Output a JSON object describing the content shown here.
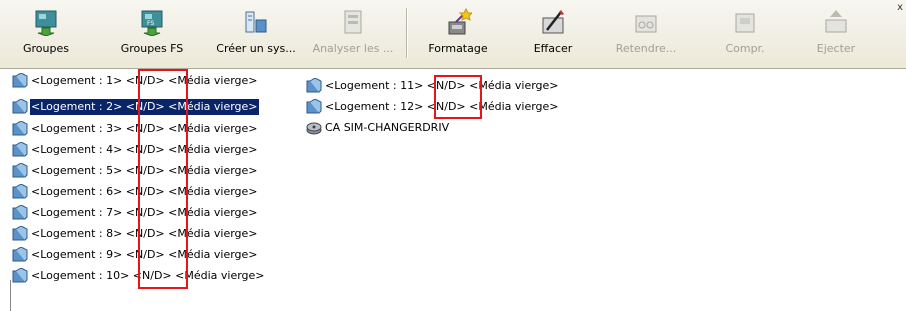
{
  "toolbar": {
    "buttons": [
      {
        "label": "Groupes",
        "icon": "group-icon",
        "enabled": true
      },
      {
        "label": "Groupes FS",
        "icon": "group-fs-icon",
        "enabled": true
      },
      {
        "label": "Créer un sys...",
        "icon": "create-system-icon",
        "enabled": true
      },
      {
        "label": "Analyser les ...",
        "icon": "analyze-icon",
        "enabled": false
      },
      {
        "label": "Formatage",
        "icon": "format-wand-icon",
        "enabled": true
      },
      {
        "label": "Effacer",
        "icon": "erase-icon",
        "enabled": true
      },
      {
        "label": "Retendre...",
        "icon": "retension-icon",
        "enabled": false
      },
      {
        "label": "Compr.",
        "icon": "compress-icon",
        "enabled": false
      },
      {
        "label": "Ejecter",
        "icon": "eject-icon",
        "enabled": false
      }
    ],
    "close_glyph": "x"
  },
  "slots": [
    {
      "text": "<Logement :  1> <N/D> <Média vierge>"
    },
    {
      "text": "<Logement :  2> <N/D> <Média vierge>"
    },
    {
      "text": "<Logement :  3> <N/D> <Média vierge>"
    },
    {
      "text": "<Logement :  4> <N/D> <Média vierge>"
    },
    {
      "text": "<Logement :  5> <N/D> <Média vierge>"
    },
    {
      "text": "<Logement :  6> <N/D> <Média vierge>"
    },
    {
      "text": "<Logement :  7> <N/D> <Média vierge>"
    },
    {
      "text": "<Logement :  8> <N/D> <Média vierge>"
    },
    {
      "text": "<Logement :  9> <N/D> <Média vierge>"
    },
    {
      "text": "<Logement : 10>  <N/D>  <Média vierge>"
    },
    {
      "text": "<Logement : 11> <N/D> <Média vierge>"
    },
    {
      "text": "<Logement : 12> <N/D> <Média vierge>"
    }
  ],
  "selected_slot": 2,
  "changer": {
    "text": "CA SIM-CHANGERDRIV",
    "icon": "changer-drive-icon"
  },
  "colors": {
    "selection": "#0a246a",
    "highlight_box": "#e8141c"
  }
}
